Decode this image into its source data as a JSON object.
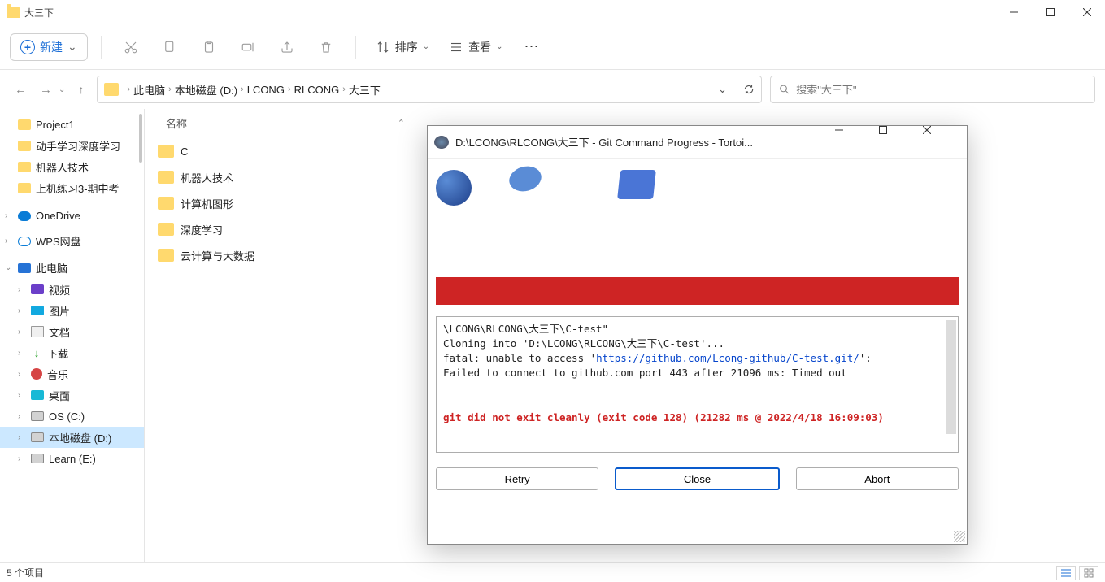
{
  "window": {
    "title": "大三下"
  },
  "toolbar": {
    "new_label": "新建",
    "sort_label": "排序",
    "view_label": "查看"
  },
  "breadcrumb": {
    "items": [
      "此电脑",
      "本地磁盘 (D:)",
      "LCONG",
      "RLCONG",
      "大三下"
    ]
  },
  "search": {
    "placeholder": "搜索\"大三下\""
  },
  "navtree": {
    "quick": [
      "Project1",
      "动手学习深度学习",
      "机器人技术",
      "上机练习3-期中考"
    ],
    "onedrive": "OneDrive",
    "wps": "WPS网盘",
    "thispc": "此电脑",
    "pc_items": [
      "视频",
      "图片",
      "文档",
      "下载",
      "音乐",
      "桌面",
      "OS (C:)",
      "本地磁盘 (D:)",
      "Learn (E:)"
    ]
  },
  "content": {
    "col_name": "名称",
    "folders": [
      "C",
      "机器人技术",
      "计算机图形",
      "深度学习",
      "云计算与大数据"
    ]
  },
  "status": {
    "count": "5 个项目"
  },
  "dialog": {
    "title": "D:\\LCONG\\RLCONG\\大三下 - Git Command Progress - Tortoi...",
    "log_line1": "\\LCONG\\RLCONG\\大三下\\C-test\"",
    "log_line2": "Cloning into 'D:\\LCONG\\RLCONG\\大三下\\C-test'...",
    "log_line3_pre": "fatal: unable to access '",
    "log_line3_url": "https://github.com/Lcong-github/C-test.git/",
    "log_line3_post": "':",
    "log_line4": "Failed to connect to github.com port 443 after 21096 ms: Timed out",
    "log_err": "git did not exit cleanly (exit code 128) (21282 ms @ 2022/4/18 16:09:03)",
    "retry": "Retry",
    "close": "Close",
    "abort": "Abort"
  }
}
